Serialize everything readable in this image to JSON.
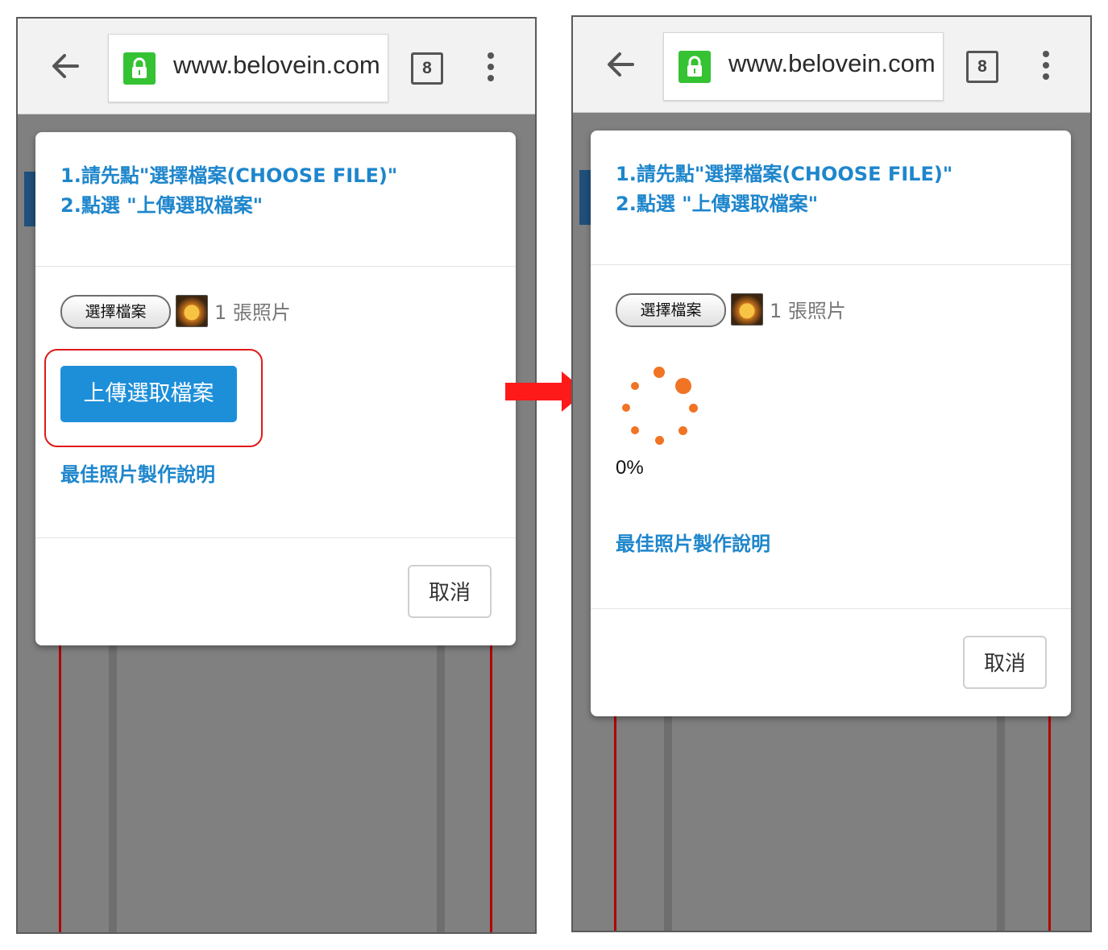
{
  "browser": {
    "url": "www.belovein.com",
    "tab_count": "8"
  },
  "dialog": {
    "instruction_line1": "1.請先點\"選擇檔案(CHOOSE FILE)\"",
    "instruction_line2": "2.點選 \"上傳選取檔案\"",
    "choose_file_label": "選擇檔案",
    "photo_count_label": "1 張照片",
    "upload_button_label": "上傳選取檔案",
    "help_link_label": "最佳照片製作說明",
    "cancel_label": "取消"
  },
  "upload_progress": {
    "percent_text": "0%",
    "progress_fraction": 0
  },
  "colors": {
    "accent_blue": "#1e86cc",
    "upload_button": "#1d8fd9",
    "lock_green": "#35c233",
    "spinner_orange": "#f07424",
    "highlight_red": "#e01919",
    "arrow_red": "#ff1a1a"
  },
  "icons": {
    "back": "arrow-left-icon",
    "lock": "lock-icon",
    "menu": "more-vertical-icon",
    "spinner": "loading-spinner-icon",
    "transition": "arrow-right-icon"
  }
}
